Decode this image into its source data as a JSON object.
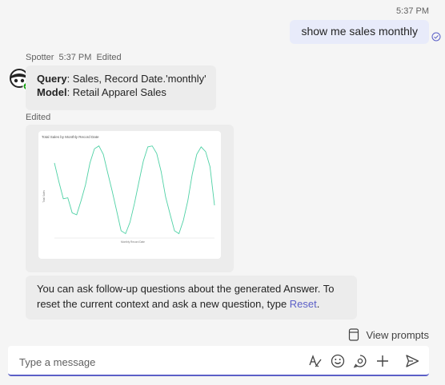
{
  "outgoing": {
    "time": "5:37 PM",
    "text": "show me sales monthly"
  },
  "incoming": {
    "sender": "Spotter",
    "time": "5:37 PM",
    "status": "Edited",
    "query_label": "Query",
    "query_value": ": Sales, Record Date.'monthly'",
    "model_label": "Model",
    "model_value": ": Retail Apparel Sales",
    "edited_label": "Edited",
    "followup_text": "You can ask follow-up questions about the generated Answer. To reset the current context and ask a new question, type ",
    "followup_link": "Reset",
    "followup_end": "."
  },
  "chart_data": {
    "type": "line",
    "title": "Total Sales by Monthly Record Date",
    "xlabel": "Monthly Record Date",
    "ylabel": "Total Sales",
    "series": [
      {
        "values": [
          0.78,
          0.58,
          0.4,
          0.41,
          0.25,
          0.23,
          0.38,
          0.55,
          0.78,
          0.93,
          0.96,
          0.87,
          0.67,
          0.48,
          0.27,
          0.06,
          0.03,
          0.15,
          0.35,
          0.58,
          0.8,
          0.95,
          0.96,
          0.88,
          0.69,
          0.42,
          0.24,
          0.06,
          0.03,
          0.17,
          0.38,
          0.66,
          0.87,
          0.95,
          0.9,
          0.74,
          0.33
        ]
      }
    ],
    "ylim": [
      0,
      1
    ],
    "color": "#4fd1a5"
  },
  "prompts": {
    "label": "View prompts"
  },
  "composer": {
    "placeholder": "Type a message"
  },
  "colors": {
    "accent": "#5b5fc7",
    "bubble_out": "#e8ebfa",
    "bubble_in": "#ececec"
  },
  "icons": [
    "read-receipt-icon",
    "avatar-icon",
    "prompts-icon",
    "format-icon",
    "emoji-icon",
    "loop-icon",
    "plus-icon",
    "send-icon"
  ]
}
